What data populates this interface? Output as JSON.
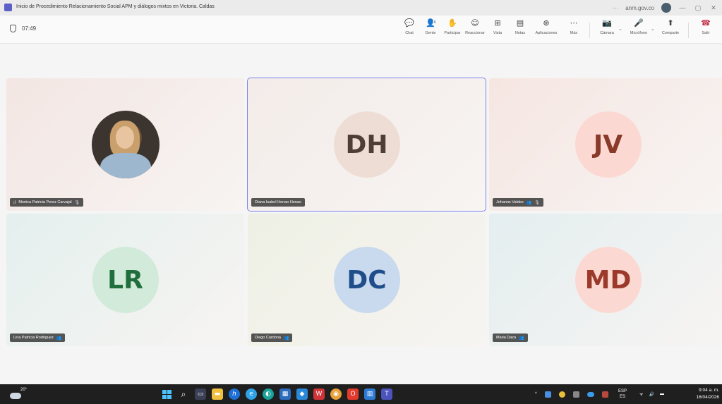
{
  "window": {
    "title": "Inicio de Procedimiento Relacionamiento Social APM y diálogos mixtos en Victoria. Caldas",
    "overflow": "···",
    "account": "anm.gov.co",
    "minimize": "—",
    "restore": "▢",
    "close": "✕"
  },
  "meeting": {
    "elapsed": "07:49",
    "toolbar": {
      "chat": "Chat",
      "people": "Gente",
      "people_count": "6",
      "raise": "Participar",
      "react": "Reaccionar",
      "view": "Vista",
      "notes": "Notas",
      "apps": "Aplicaciones",
      "more": "Más",
      "camera": "Cámara",
      "mic": "Micrófono",
      "share": "Comparte",
      "leave": "Salir"
    }
  },
  "participants": [
    {
      "name": "Monica Patricia Perez Carvajal",
      "initials": "",
      "has_photo": true,
      "bg": "#f3e6e3",
      "avatar_bg": "",
      "avatar_fg": "",
      "active": false
    },
    {
      "name": "Diana Isabel Henao Henao",
      "initials": "DH",
      "has_photo": false,
      "bg": "#f3ece9",
      "avatar_bg": "#eeddd5",
      "avatar_fg": "#4e3e36",
      "active": true
    },
    {
      "name": "Johanns Valdes",
      "initials": "JV",
      "has_photo": false,
      "bg": "#f6e6e2",
      "avatar_bg": "#fbd9d2",
      "avatar_fg": "#8a3a2a",
      "active": false
    },
    {
      "name": "Lina Patricia Rodriguez",
      "initials": "LR",
      "has_photo": false,
      "bg": "#e4f0ee",
      "avatar_bg": "#d2ead9",
      "avatar_fg": "#1f6e3b",
      "active": false
    },
    {
      "name": "Diego Cardona",
      "initials": "DC",
      "has_photo": false,
      "bg": "#eef0e4",
      "avatar_bg": "#c9d9ee",
      "avatar_fg": "#1f4e8a",
      "active": false
    },
    {
      "name": "Maria Daza",
      "initials": "MD",
      "has_photo": false,
      "bg": "#e4eef0",
      "avatar_bg": "#fbd9d2",
      "avatar_fg": "#9b3a2a",
      "active": false
    }
  ],
  "taskbar": {
    "temperature": "20°",
    "tray_language": "ESP",
    "tray_region": "ES",
    "time": "9:04 a. m.",
    "date": "16/04/2026",
    "chevron": "^"
  }
}
